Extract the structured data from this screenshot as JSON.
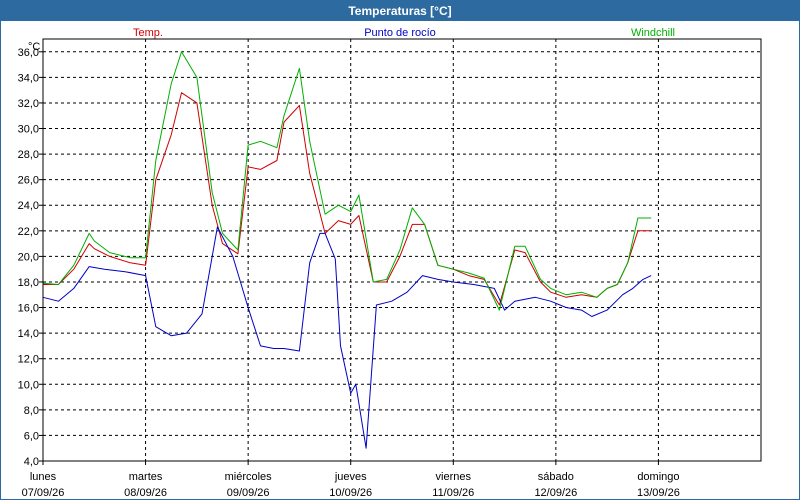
{
  "window": {
    "title": "Temperaturas [°C]"
  },
  "chart_data": {
    "type": "line",
    "title": "Temperaturas [°C]",
    "ylabel": "°C",
    "ylim": [
      4,
      37
    ],
    "yticks": [
      4,
      6,
      8,
      10,
      12,
      14,
      16,
      18,
      20,
      22,
      24,
      26,
      28,
      30,
      32,
      34,
      36
    ],
    "ytick_labels": [
      "4,0",
      "6,0",
      "8,0",
      "10,0",
      "12,0",
      "14,0",
      "16,0",
      "18,0",
      "20,0",
      "22,0",
      "24,0",
      "26,0",
      "28,0",
      "30,0",
      "32,0",
      "34,0",
      "36,0"
    ],
    "xlim": [
      0,
      7
    ],
    "xticks": [
      {
        "day": "lunes",
        "date": "07/09/26"
      },
      {
        "day": "martes",
        "date": "08/09/26"
      },
      {
        "day": "miércoles",
        "date": "09/09/26"
      },
      {
        "day": "jueves",
        "date": "10/09/26"
      },
      {
        "day": "viernes",
        "date": "11/09/26"
      },
      {
        "day": "sábado",
        "date": "12/09/26"
      },
      {
        "day": "domingo",
        "date": "13/09/26"
      }
    ],
    "grid": true,
    "legend_position": "top",
    "series": [
      {
        "name": "Temp.",
        "color": "#d00000",
        "x": [
          0,
          0.15,
          0.3,
          0.45,
          0.5,
          0.65,
          0.85,
          1.0,
          1.1,
          1.25,
          1.35,
          1.5,
          1.65,
          1.75,
          1.9,
          2.0,
          2.12,
          2.28,
          2.35,
          2.5,
          2.6,
          2.75,
          2.88,
          3.0,
          3.08,
          3.22,
          3.35,
          3.48,
          3.6,
          3.72,
          3.85,
          4.0,
          4.15,
          4.3,
          4.45,
          4.6,
          4.7,
          4.85,
          4.95,
          5.1,
          5.25,
          5.4,
          5.5,
          5.6,
          5.7,
          5.8,
          5.87,
          5.93
        ],
        "y": [
          17.8,
          17.8,
          19.0,
          21.0,
          20.6,
          20.0,
          19.5,
          19.3,
          26.0,
          29.5,
          32.8,
          32.0,
          24.0,
          21.0,
          20.2,
          27.0,
          26.8,
          27.5,
          30.5,
          31.8,
          26.5,
          21.8,
          22.8,
          22.5,
          23.2,
          18.0,
          18.0,
          20.0,
          22.5,
          22.5,
          19.3,
          19.0,
          18.5,
          18.2,
          16.2,
          20.5,
          20.3,
          18.0,
          17.2,
          16.8,
          17.0,
          16.8,
          17.5,
          17.8,
          19.5,
          22.0,
          22.0,
          22.0
        ]
      },
      {
        "name": "Punto de rocío",
        "color": "#0000c8",
        "x": [
          0,
          0.15,
          0.3,
          0.45,
          0.6,
          0.8,
          1.0,
          1.1,
          1.25,
          1.4,
          1.55,
          1.7,
          1.85,
          2.0,
          2.12,
          2.25,
          2.35,
          2.5,
          2.6,
          2.7,
          2.75,
          2.85,
          2.9,
          3.0,
          3.05,
          3.15,
          3.25,
          3.4,
          3.55,
          3.7,
          3.85,
          4.0,
          4.2,
          4.4,
          4.5,
          4.6,
          4.8,
          4.95,
          5.1,
          5.25,
          5.35,
          5.5,
          5.65,
          5.75,
          5.85,
          5.93
        ],
        "y": [
          16.8,
          16.5,
          17.5,
          19.2,
          19.0,
          18.8,
          18.5,
          14.5,
          13.8,
          14.0,
          15.5,
          22.3,
          20.0,
          16.0,
          13.0,
          12.8,
          12.8,
          12.6,
          19.5,
          21.8,
          21.8,
          19.8,
          13.0,
          9.3,
          10.0,
          5.0,
          16.2,
          16.5,
          17.2,
          18.5,
          18.2,
          18.0,
          17.8,
          17.5,
          15.8,
          16.5,
          16.8,
          16.5,
          16.0,
          15.8,
          15.3,
          15.8,
          17.0,
          17.5,
          18.2,
          18.5
        ]
      },
      {
        "name": "Windchill",
        "color": "#00b000",
        "x": [
          0,
          0.15,
          0.3,
          0.45,
          0.5,
          0.65,
          0.85,
          1.0,
          1.1,
          1.25,
          1.35,
          1.5,
          1.65,
          1.75,
          1.9,
          2.0,
          2.12,
          2.28,
          2.35,
          2.5,
          2.6,
          2.75,
          2.88,
          3.0,
          3.08,
          3.22,
          3.35,
          3.48,
          3.6,
          3.72,
          3.85,
          4.0,
          4.15,
          4.3,
          4.45,
          4.6,
          4.7,
          4.85,
          4.95,
          5.1,
          5.25,
          5.4,
          5.5,
          5.6,
          5.7,
          5.8,
          5.87,
          5.93
        ],
        "y": [
          17.9,
          17.8,
          19.3,
          21.8,
          21.2,
          20.3,
          19.9,
          19.9,
          27.5,
          33.5,
          36.0,
          34.0,
          25.0,
          21.8,
          20.5,
          28.7,
          29.0,
          28.5,
          31.0,
          34.7,
          29.0,
          23.3,
          24.0,
          23.5,
          24.8,
          18.0,
          18.2,
          20.5,
          23.8,
          22.5,
          19.3,
          19.0,
          18.7,
          18.3,
          15.8,
          20.8,
          20.8,
          18.2,
          17.5,
          17.0,
          17.2,
          16.8,
          17.5,
          17.8,
          19.5,
          23.0,
          23.0,
          23.0
        ]
      }
    ]
  }
}
